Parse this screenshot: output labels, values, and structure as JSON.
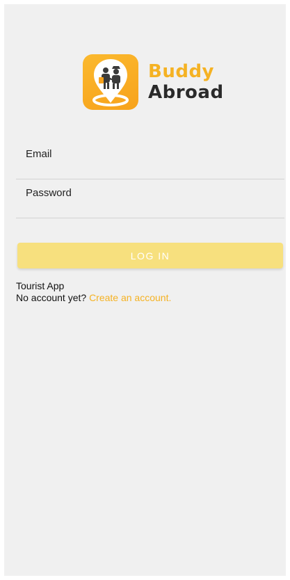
{
  "app": {
    "logo_line1": "Buddy",
    "logo_line2": "Abroad",
    "logo_icon": "map-pin-travellers-icon"
  },
  "form": {
    "email_placeholder": "Email",
    "password_placeholder": "Password",
    "login_label": "LOG IN"
  },
  "footer": {
    "app_type": "Tourist App",
    "no_account_text": "No account yet?",
    "create_account_link": "Create an account."
  },
  "colors": {
    "brand_yellow": "#f5b223",
    "button_disabled": "#f7e07e",
    "background": "#f0f0f0"
  }
}
